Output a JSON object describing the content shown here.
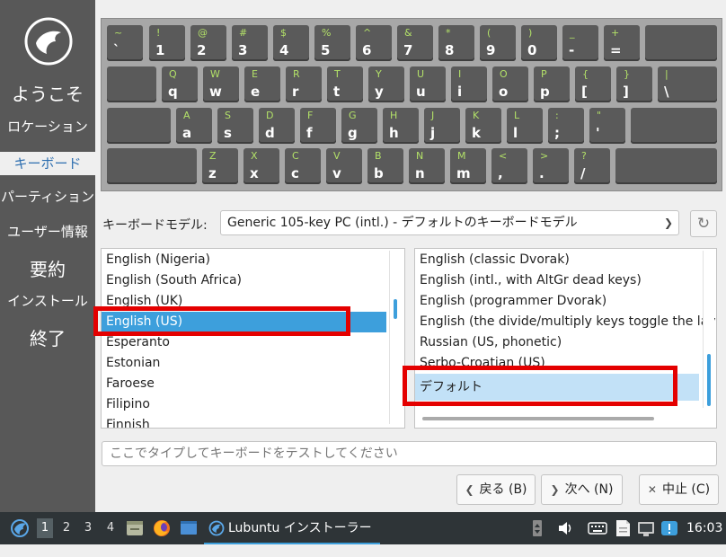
{
  "sidebar": {
    "items": [
      {
        "label": "ようこそ",
        "big": true,
        "active": false
      },
      {
        "label": "ロケーション",
        "big": false,
        "active": false
      },
      {
        "label": "キーボード",
        "big": false,
        "active": true
      },
      {
        "label": "パーティション",
        "big": false,
        "active": false
      },
      {
        "label": "ユーザー情報",
        "big": false,
        "active": false
      },
      {
        "label": "要約",
        "big": true,
        "active": false
      },
      {
        "label": "インストール",
        "big": false,
        "active": false
      },
      {
        "label": "終了",
        "big": true,
        "active": false
      }
    ]
  },
  "keyboard": {
    "rows": [
      [
        {
          "sec": "~",
          "pri": "`"
        },
        {
          "sec": "!",
          "pri": "1"
        },
        {
          "sec": "@",
          "pri": "2"
        },
        {
          "sec": "#",
          "pri": "3"
        },
        {
          "sec": "$",
          "pri": "4"
        },
        {
          "sec": "%",
          "pri": "5"
        },
        {
          "sec": "^",
          "pri": "6"
        },
        {
          "sec": "&",
          "pri": "7"
        },
        {
          "sec": "*",
          "pri": "8"
        },
        {
          "sec": "(",
          "pri": "9"
        },
        {
          "sec": ")",
          "pri": "0"
        },
        {
          "sec": "_",
          "pri": "-"
        },
        {
          "sec": "+",
          "pri": "="
        },
        {
          "sec": "",
          "pri": ""
        }
      ],
      [
        {
          "sec": "",
          "pri": ""
        },
        {
          "sec": "Q",
          "pri": "q"
        },
        {
          "sec": "W",
          "pri": "w"
        },
        {
          "sec": "E",
          "pri": "e"
        },
        {
          "sec": "R",
          "pri": "r"
        },
        {
          "sec": "T",
          "pri": "t"
        },
        {
          "sec": "Y",
          "pri": "y"
        },
        {
          "sec": "U",
          "pri": "u"
        },
        {
          "sec": "I",
          "pri": "i"
        },
        {
          "sec": "O",
          "pri": "o"
        },
        {
          "sec": "P",
          "pri": "p"
        },
        {
          "sec": "{",
          "pri": "["
        },
        {
          "sec": "}",
          "pri": "]"
        },
        {
          "sec": "|",
          "pri": "\\"
        }
      ],
      [
        {
          "sec": "",
          "pri": ""
        },
        {
          "sec": "A",
          "pri": "a"
        },
        {
          "sec": "S",
          "pri": "s"
        },
        {
          "sec": "D",
          "pri": "d"
        },
        {
          "sec": "F",
          "pri": "f"
        },
        {
          "sec": "G",
          "pri": "g"
        },
        {
          "sec": "H",
          "pri": "h"
        },
        {
          "sec": "J",
          "pri": "j"
        },
        {
          "sec": "K",
          "pri": "k"
        },
        {
          "sec": "L",
          "pri": "l"
        },
        {
          "sec": ":",
          "pri": ";"
        },
        {
          "sec": "\"",
          "pri": "'"
        },
        {
          "sec": "",
          "pri": ""
        }
      ],
      [
        {
          "sec": "",
          "pri": ""
        },
        {
          "sec": "Z",
          "pri": "z"
        },
        {
          "sec": "X",
          "pri": "x"
        },
        {
          "sec": "C",
          "pri": "c"
        },
        {
          "sec": "V",
          "pri": "v"
        },
        {
          "sec": "B",
          "pri": "b"
        },
        {
          "sec": "N",
          "pri": "n"
        },
        {
          "sec": "M",
          "pri": "m"
        },
        {
          "sec": "<",
          "pri": ","
        },
        {
          "sec": ">",
          "pri": "."
        },
        {
          "sec": "?",
          "pri": "/"
        },
        {
          "sec": "",
          "pri": ""
        }
      ]
    ]
  },
  "model": {
    "label": "キーボードモデル:",
    "value": "Generic 105-key PC (intl.)  -  デフォルトのキーボードモデル",
    "reset_icon": "reset-icon"
  },
  "layouts": {
    "items": [
      "English (Nigeria)",
      "English (South Africa)",
      "English (UK)",
      "English (US)",
      "Esperanto",
      "Estonian",
      "Faroese",
      "Filipino",
      "Finnish"
    ],
    "selected_index": 3
  },
  "variants": {
    "items": [
      "English (classic Dvorak)",
      "English (intl., with AltGr dead keys)",
      "English (programmer Dvorak)",
      "English (the divide/multiply keys toggle the layout)",
      "Russian (US, phonetic)",
      "Serbo-Croatian (US)",
      "デフォルト"
    ],
    "selected_index": 6
  },
  "test_input": {
    "placeholder": "ここでタイプしてキーボードをテストしてください",
    "value": ""
  },
  "buttons": {
    "back": "戻る (B)",
    "next": "次へ (N)",
    "cancel": "中止 (C)"
  },
  "taskbar": {
    "workspaces": [
      "1",
      "2",
      "3",
      "4"
    ],
    "active_workspace": "1",
    "app_title": "Lubuntu インストーラー",
    "clock": "16:03"
  },
  "colors": {
    "sidebar": "#585858",
    "selection": "#3d9fdc",
    "highlight": "#e40000",
    "key_legend": "#b2e068"
  }
}
